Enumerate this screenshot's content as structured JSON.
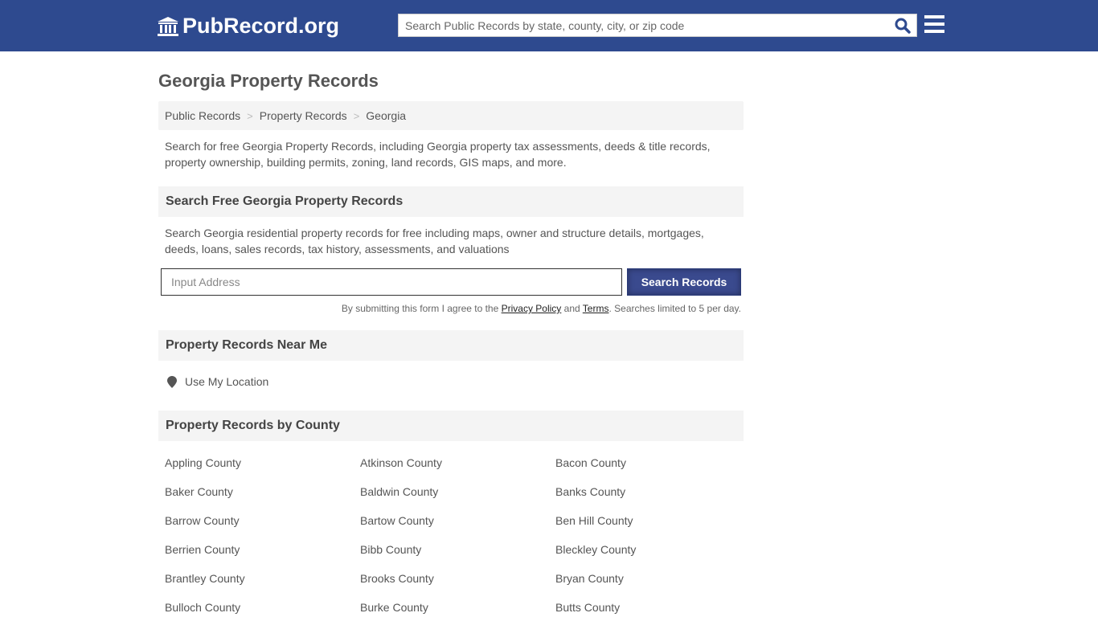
{
  "header": {
    "logo_text": "PubRecord.org",
    "search_placeholder": "Search Public Records by state, county, city, or zip code"
  },
  "page": {
    "title": "Georgia Property Records",
    "breadcrumbs": [
      "Public Records",
      "Property Records",
      "Georgia"
    ],
    "breadcrumb_separator": ">",
    "description": "Search for free Georgia Property Records, including Georgia property tax assessments, deeds & title records, property ownership, building permits, zoning, land records, GIS maps, and more."
  },
  "search_section": {
    "heading": "Search Free Georgia Property Records",
    "description": "Search Georgia residential property records for free including maps, owner and structure details, mortgages, deeds, loans, sales records, tax history, assessments, and valuations",
    "input_placeholder": "Input Address",
    "button_label": "Search Records",
    "terms_prefix": "By submitting this form I agree to the ",
    "privacy_link": "Privacy Policy",
    "terms_and": " and ",
    "terms_link": "Terms",
    "terms_suffix": ". Searches limited to 5 per day."
  },
  "near_me": {
    "heading": "Property Records Near Me",
    "location_label": "Use My Location"
  },
  "by_county": {
    "heading": "Property Records by County",
    "counties": [
      "Appling County",
      "Atkinson County",
      "Bacon County",
      "Baker County",
      "Baldwin County",
      "Banks County",
      "Barrow County",
      "Bartow County",
      "Ben Hill County",
      "Berrien County",
      "Bibb County",
      "Bleckley County",
      "Brantley County",
      "Brooks County",
      "Bryan County",
      "Bulloch County",
      "Burke County",
      "Butts County"
    ]
  },
  "colors": {
    "header_bg": "#2e4a8f",
    "button_bg": "#3a4a8e",
    "section_bg": "#f4f4f4"
  }
}
